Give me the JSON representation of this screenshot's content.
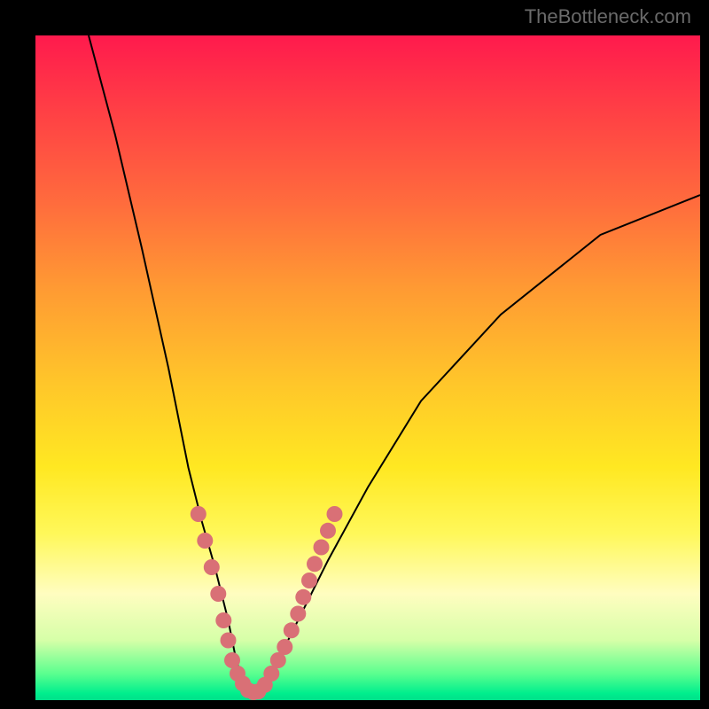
{
  "watermark": "TheBottleneck.com",
  "chart_data": {
    "type": "line",
    "title": "",
    "xlabel": "",
    "ylabel": "",
    "x_range": [
      0,
      100
    ],
    "y_range": [
      0,
      100
    ],
    "series": [
      {
        "name": "bottleneck-curve",
        "description": "V-shaped bottleneck curve, minimum near x≈32 y≈0",
        "x": [
          8,
          12,
          16,
          20,
          23,
          25,
          27,
          29,
          30,
          31,
          32,
          33,
          35,
          37,
          40,
          44,
          50,
          58,
          70,
          85,
          100
        ],
        "y": [
          100,
          85,
          68,
          50,
          35,
          27,
          20,
          12,
          7,
          3,
          1,
          1,
          3,
          7,
          13,
          21,
          32,
          45,
          58,
          70,
          76
        ]
      },
      {
        "name": "highlight-dots-left",
        "description": "Pink/coral dots along lower-left arm of curve",
        "x": [
          24.5,
          25.5,
          26.5,
          27.5,
          28.3,
          29.0,
          29.6,
          30.4,
          31.2,
          32.0,
          32.8
        ],
        "y": [
          28,
          24,
          20,
          16,
          12,
          9,
          6,
          4,
          2.5,
          1.5,
          1.2
        ]
      },
      {
        "name": "highlight-dots-right",
        "description": "Pink/coral dots along lower-right arm of curve",
        "x": [
          33.5,
          34.5,
          35.5,
          36.5,
          37.5,
          38.5,
          39.5,
          40.3,
          41.2,
          42.0,
          43.0,
          44.0,
          45.0
        ],
        "y": [
          1.3,
          2.3,
          4.0,
          6.0,
          8.0,
          10.5,
          13.0,
          15.5,
          18.0,
          20.5,
          23.0,
          25.5,
          28.0
        ]
      }
    ],
    "colors": {
      "curve": "#000000",
      "dots": "#d97076",
      "gradient_top": "#ff1a4d",
      "gradient_mid": "#ffe822",
      "gradient_bottom": "#00e08a",
      "background": "#000000"
    }
  }
}
